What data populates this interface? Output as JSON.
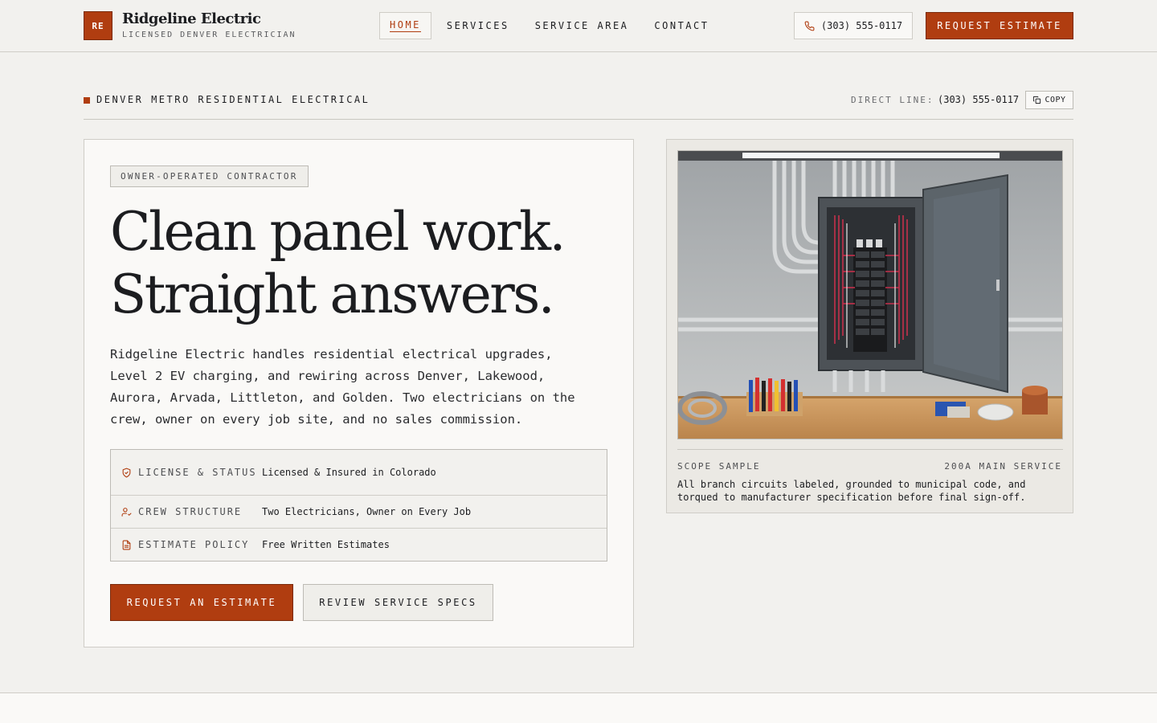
{
  "header": {
    "logo_mark": "RE",
    "brand_name": "Ridgeline Electric",
    "brand_tagline": "LICENSED DENVER ELECTRICIAN",
    "nav": [
      {
        "label": "HOME",
        "active": true
      },
      {
        "label": "SERVICES",
        "active": false
      },
      {
        "label": "SERVICE AREA",
        "active": false
      },
      {
        "label": "CONTACT",
        "active": false
      }
    ],
    "phone": "(303) 555-0117",
    "phone_icon": "phone-icon",
    "cta": "REQUEST ESTIMATE"
  },
  "subbar": {
    "title": "DENVER METRO RESIDENTIAL ELECTRICAL",
    "direct_label": "DIRECT LINE:",
    "direct_number": "(303) 555-0117",
    "copy_label": "COPY",
    "copy_icon": "copy-icon"
  },
  "hero": {
    "tag": "OWNER-OPERATED CONTRACTOR",
    "headline_line1": "Clean panel work.",
    "headline_line2": "Straight answers.",
    "lede": "Ridgeline Electric handles residential electrical upgrades, Level 2 EV charging, and rewiring across Denver, Lakewood, Aurora, Arvada, Littleton, and Golden. Two electricians on the crew, owner on every job site, and no sales commission.",
    "specs": [
      {
        "icon": "shield-check-icon",
        "label": "LICENSE & STATUS",
        "value": "Licensed & Insured in Colorado"
      },
      {
        "icon": "user-check-icon",
        "label": "CREW STRUCTURE",
        "value": "Two Electricians, Owner on Every Job"
      },
      {
        "icon": "document-icon",
        "label": "ESTIMATE POLICY",
        "value": "Free Written Estimates"
      }
    ],
    "primary_cta": "REQUEST AN ESTIMATE",
    "secondary_cta": "REVIEW SERVICE SPECS"
  },
  "scope": {
    "label": "SCOPE SAMPLE",
    "spec": "200A MAIN SERVICE",
    "caption": "All branch circuits labeled, grounded to municipal code, and torqued to manufacturer specification before final sign-off."
  },
  "colors": {
    "accent": "#b03d10",
    "background": "#f2f1ee",
    "card": "#faf9f7",
    "text": "#1c1d20"
  }
}
